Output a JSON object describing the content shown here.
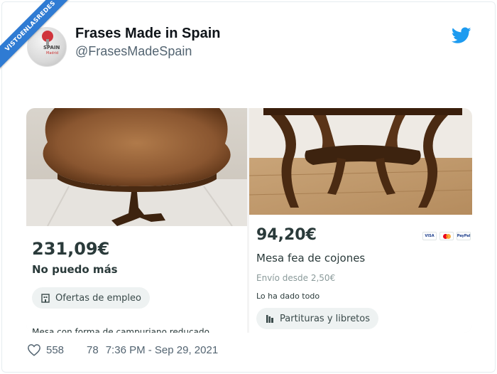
{
  "watermark": "VISTOENLASREDES",
  "tweet": {
    "display_name": "Frases Made in Spain",
    "handle": "@FrasesMadeSpain",
    "avatar_text": "SPAIN",
    "avatar_subtext": "Madrid"
  },
  "listing_left": {
    "price": "231,09€",
    "title": "No puedo más",
    "chip_label": "Ofertas de empleo",
    "chip_icon": "building-icon",
    "truncated_text": "Mesa con forma de campuriano reducado"
  },
  "listing_right": {
    "price": "94,20€",
    "title": "Mesa fea de cojones",
    "shipping": "Envío desde 2,50€",
    "note": "Lo ha dado todo",
    "chip_label": "Partituras y libretos",
    "chip_icon": "books-icon",
    "payment_methods": [
      "VISA",
      "MC",
      "PayPal"
    ]
  },
  "footer": {
    "likes": "558",
    "replies": "78",
    "timestamp": "7:36 PM - Sep 29, 2021"
  },
  "colors": {
    "twitter_blue": "#1d9bf0",
    "ribbon_blue": "#2f7bd3",
    "price_text": "#2a3a3a",
    "muted": "#536471"
  }
}
